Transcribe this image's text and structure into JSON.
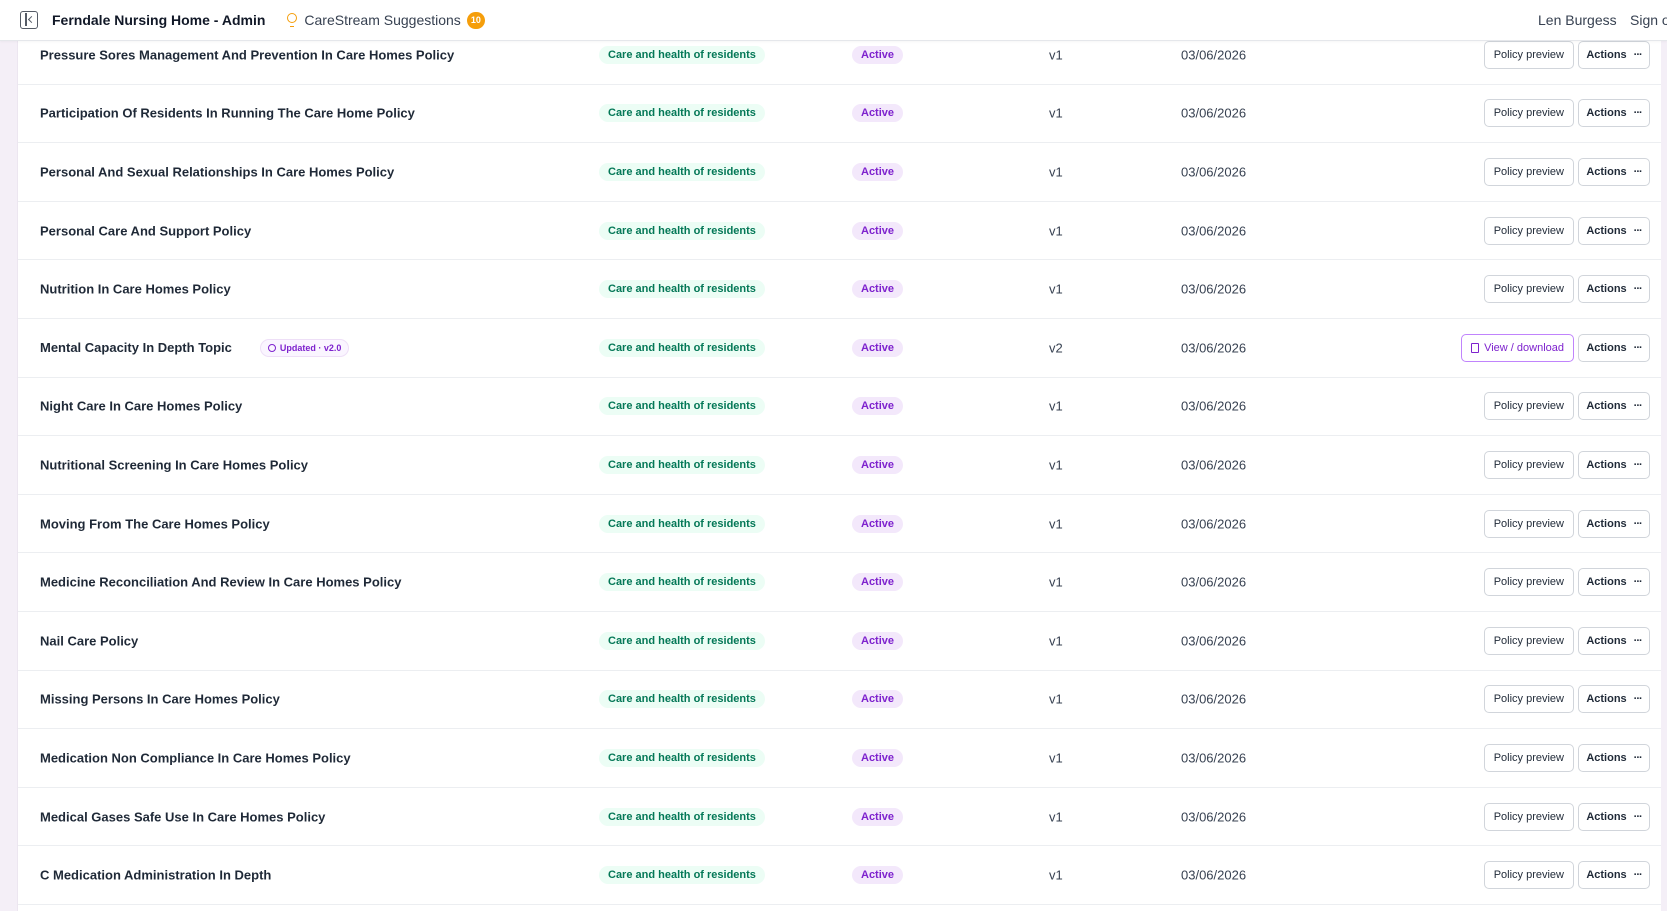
{
  "header": {
    "app_title": "Ferndale Nursing Home - Admin",
    "suggestions_label": "CareStream Suggestions",
    "suggestions_count": "10",
    "user_name": "Len Burgess",
    "sign_out": "Sign out"
  },
  "colors": {
    "accent": "#7e22ce",
    "category_text": "#047857",
    "category_bg": "#ecfdf5",
    "status_bg": "#f3e8fb",
    "badge": "#f59e0b"
  },
  "icons": [
    "sidebar-toggle-icon",
    "lightbulb-icon",
    "check-circle-icon",
    "document-icon",
    "more-dots-icon"
  ],
  "rows": [
    {
      "name": "Pressure Sores Management And Prevention In Care Homes Policy",
      "category": "Care and health of residents",
      "status": "Active",
      "version": "v1",
      "date": "03/06/2026",
      "preview_label": "Policy preview",
      "actions_label": "Actions"
    },
    {
      "name": "Participation Of Residents In Running The Care Home Policy",
      "category": "Care and health of residents",
      "status": "Active",
      "version": "v1",
      "date": "03/06/2026",
      "preview_label": "Policy preview",
      "actions_label": "Actions"
    },
    {
      "name": "Personal And Sexual Relationships In Care Homes Policy",
      "category": "Care and health of residents",
      "status": "Active",
      "version": "v1",
      "date": "03/06/2026",
      "preview_label": "Policy preview",
      "actions_label": "Actions"
    },
    {
      "name": "Personal Care And Support Policy",
      "category": "Care and health of residents",
      "status": "Active",
      "version": "v1",
      "date": "03/06/2026",
      "preview_label": "Policy preview",
      "actions_label": "Actions"
    },
    {
      "name": "Nutrition In Care Homes Policy",
      "category": "Care and health of residents",
      "status": "Active",
      "version": "v1",
      "date": "03/06/2026",
      "preview_label": "Policy preview",
      "actions_label": "Actions"
    },
    {
      "name": "Mental Capacity In Depth Topic",
      "badge": "Updated · v2.0",
      "category": "Care and health of residents",
      "status": "Active",
      "version": "v2",
      "date": "03/06/2026",
      "preview_label": "View / download",
      "actions_label": "Actions"
    },
    {
      "name": "Night Care In Care Homes Policy",
      "category": "Care and health of residents",
      "status": "Active",
      "version": "v1",
      "date": "03/06/2026",
      "preview_label": "Policy preview",
      "actions_label": "Actions"
    },
    {
      "name": "Nutritional Screening In Care Homes Policy",
      "category": "Care and health of residents",
      "status": "Active",
      "version": "v1",
      "date": "03/06/2026",
      "preview_label": "Policy preview",
      "actions_label": "Actions"
    },
    {
      "name": "Moving From The Care Homes Policy",
      "category": "Care and health of residents",
      "status": "Active",
      "version": "v1",
      "date": "03/06/2026",
      "preview_label": "Policy preview",
      "actions_label": "Actions"
    },
    {
      "name": "Medicine Reconciliation And Review In Care Homes Policy",
      "category": "Care and health of residents",
      "status": "Active",
      "version": "v1",
      "date": "03/06/2026",
      "preview_label": "Policy preview",
      "actions_label": "Actions"
    },
    {
      "name": "Nail Care Policy",
      "category": "Care and health of residents",
      "status": "Active",
      "version": "v1",
      "date": "03/06/2026",
      "preview_label": "Policy preview",
      "actions_label": "Actions"
    },
    {
      "name": "Missing Persons In Care Homes Policy",
      "category": "Care and health of residents",
      "status": "Active",
      "version": "v1",
      "date": "03/06/2026",
      "preview_label": "Policy preview",
      "actions_label": "Actions"
    },
    {
      "name": "Medication Non Compliance In Care Homes Policy",
      "category": "Care and health of residents",
      "status": "Active",
      "version": "v1",
      "date": "03/06/2026",
      "preview_label": "Policy preview",
      "actions_label": "Actions"
    },
    {
      "name": "Medical Gases Safe Use In Care Homes Policy",
      "category": "Care and health of residents",
      "status": "Active",
      "version": "v1",
      "date": "03/06/2026",
      "preview_label": "Policy preview",
      "actions_label": "Actions"
    },
    {
      "name": "C Medication Administration In Depth",
      "category": "Care and health of residents",
      "status": "Active",
      "version": "v1",
      "date": "03/06/2026",
      "preview_label": "Policy preview",
      "actions_label": "Actions"
    }
  ]
}
